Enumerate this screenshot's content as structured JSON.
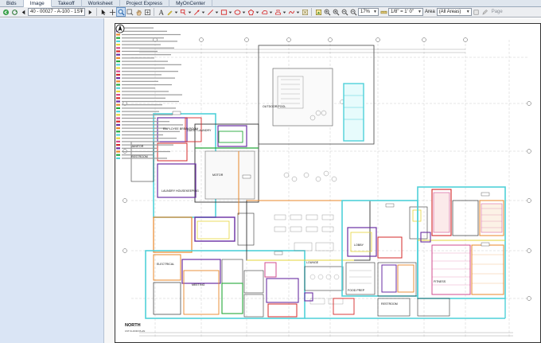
{
  "tabs": [
    {
      "label": "Bids",
      "active": false
    },
    {
      "label": "Image",
      "active": true
    },
    {
      "label": "Takeoff",
      "active": false
    },
    {
      "label": "Worksheet",
      "active": false
    },
    {
      "label": "Project Express",
      "active": false
    },
    {
      "label": "MyOnCenter",
      "active": false
    }
  ],
  "toolbar": {
    "page_select": "40 - 00027 - A-100 - 1ST",
    "zoom_select": "17%",
    "scale_select": "1/8\" = 1' 0\"",
    "area_label": "Area",
    "area_select": "(All Areas)",
    "page_label": "Page"
  },
  "plan": {
    "north_label": "NORTH",
    "title": "1ST FLOOR PLAN",
    "rooms": [
      {
        "id": "r1",
        "text": "OUTDOOR POOL"
      },
      {
        "id": "r2",
        "text": "EMPLOYEE BREAKROOM"
      },
      {
        "id": "r3",
        "text": "GUEST LAUNDRY"
      },
      {
        "id": "r4",
        "text": "MOTOR"
      },
      {
        "id": "r5",
        "text": "LAUNDRY HOUSEKEEPING"
      },
      {
        "id": "r6",
        "text": "JANITOR"
      },
      {
        "id": "r7",
        "text": "RESTROOM"
      },
      {
        "id": "r8",
        "text": "ELECTRICAL"
      },
      {
        "id": "r9",
        "text": "LOUNGE"
      },
      {
        "id": "r10",
        "text": "FOOD PREP"
      },
      {
        "id": "r11",
        "text": "RESTROOM"
      },
      {
        "id": "r12",
        "text": "MEETING"
      },
      {
        "id": "r13",
        "text": "FITNESS"
      },
      {
        "id": "r14",
        "text": "LOBBY"
      }
    ]
  },
  "colors": {
    "accent": "#3a78c3",
    "markup_cyan": "#4fd1d9",
    "markup_purple": "#6a2ea3",
    "markup_green": "#25a83a",
    "markup_orange": "#e8872a",
    "markup_red": "#d62828",
    "markup_yellow": "#e6d43a",
    "markup_pink": "#d14c8f"
  }
}
